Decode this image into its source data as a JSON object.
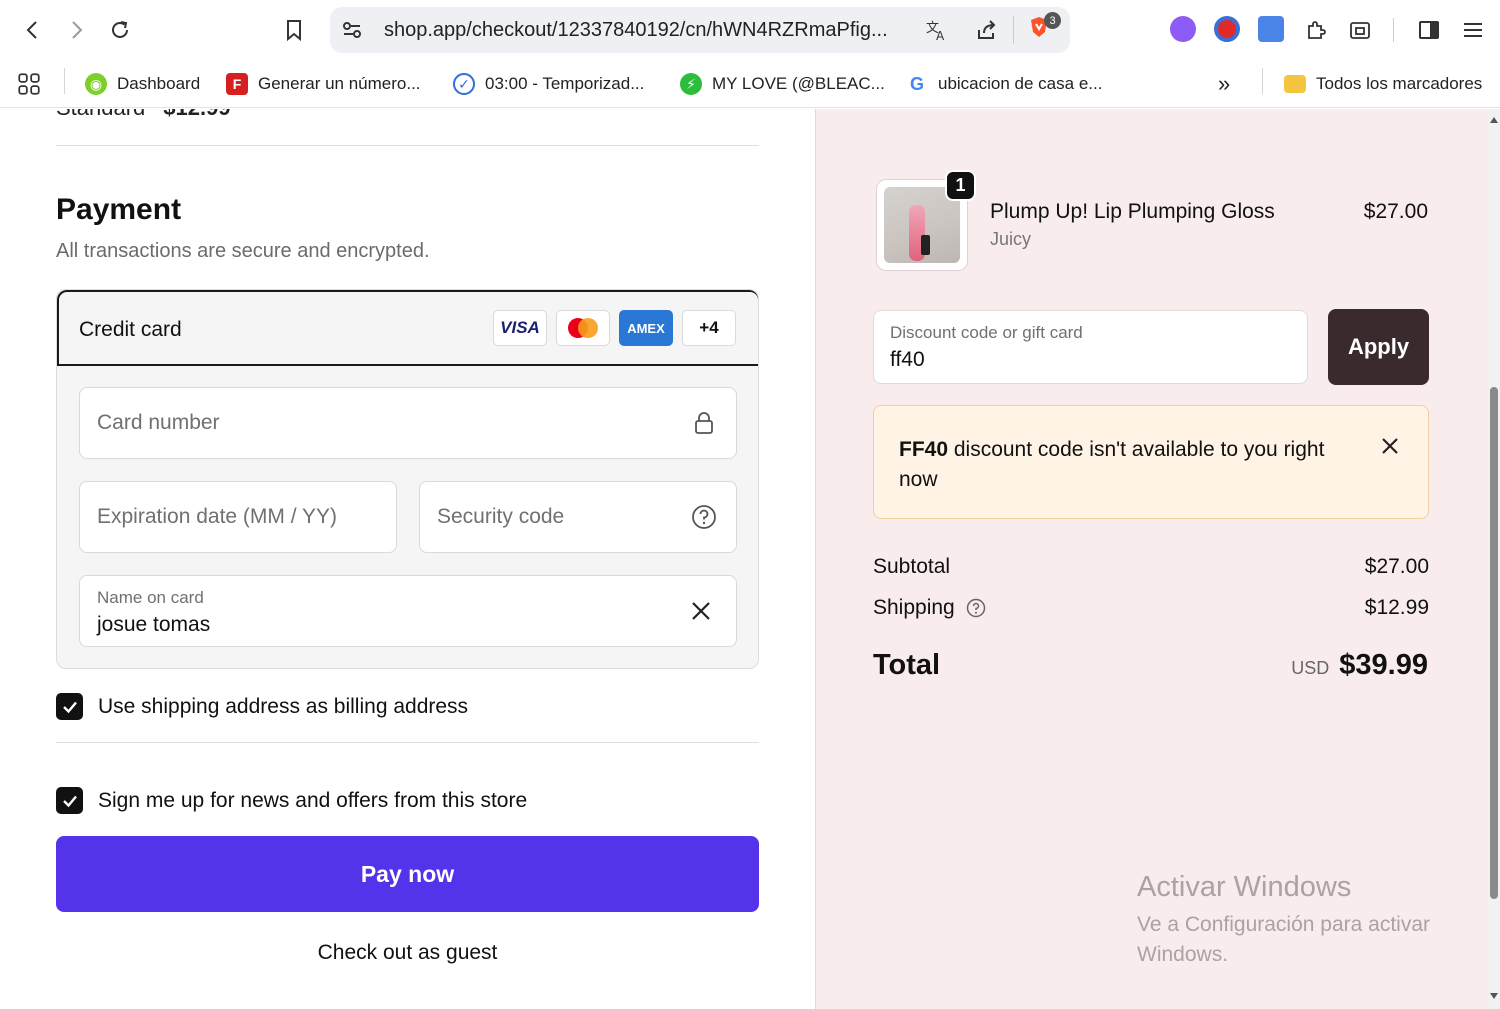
{
  "browser": {
    "url": "shop.app/checkout/12337840192/cn/hWN4RZRmaPfig...",
    "shield_badge": "3",
    "bookmarks": [
      {
        "label": "Dashboard"
      },
      {
        "label": "Generar un número..."
      },
      {
        "label": "03:00 - Temporizad..."
      },
      {
        "label": "MY LOVE (@BLEAC..."
      },
      {
        "label": "ubicacion de casa e..."
      }
    ],
    "bookmarks_more": "»",
    "all_bookmarks": "Todos los marcadores",
    "favicon_letters": {
      "generar": "F",
      "ubicacion": "G"
    }
  },
  "shipping_summary": {
    "label": "Standard",
    "price": "$12.99"
  },
  "payment": {
    "title": "Payment",
    "subtitle": "All transactions are secure and encrypted.",
    "method_label": "Credit card",
    "card_logos": {
      "visa": "VISA",
      "amex": "AMEX",
      "more": "+4"
    },
    "card_number_placeholder": "Card number",
    "expiry_placeholder": "Expiration date (MM / YY)",
    "security_placeholder": "Security code",
    "name_label": "Name on card",
    "name_value": "josue tomas",
    "billing_checkbox": "Use shipping address as billing address",
    "billing_checked": true,
    "newsletter_checkbox": "Sign me up for news and offers from this store",
    "newsletter_checked": true,
    "pay_button": "Pay now",
    "guest_link": "Check out as guest"
  },
  "order": {
    "item": {
      "name": "Plump Up! Lip Plumping Gloss",
      "variant": "Juicy",
      "price": "$27.00",
      "quantity": "1"
    },
    "discount_label": "Discount code or gift card",
    "discount_value": "ff40",
    "apply_button": "Apply",
    "alert": {
      "code": "FF40",
      "message": " discount code isn't available to you right now"
    },
    "subtotal_label": "Subtotal",
    "subtotal_value": "$27.00",
    "shipping_label": "Shipping",
    "shipping_value": "$12.99",
    "total_label": "Total",
    "total_currency": "USD",
    "total_value": "$39.99"
  },
  "watermark": {
    "title": "Activar Windows",
    "subtitle": "Ve a Configuración para activar Windows."
  },
  "colors": {
    "pay_button": "#5433eb",
    "apply_button": "#3a2a2e",
    "sidebar_bg": "#f9ecec",
    "alert_bg": "#fff3e6"
  }
}
